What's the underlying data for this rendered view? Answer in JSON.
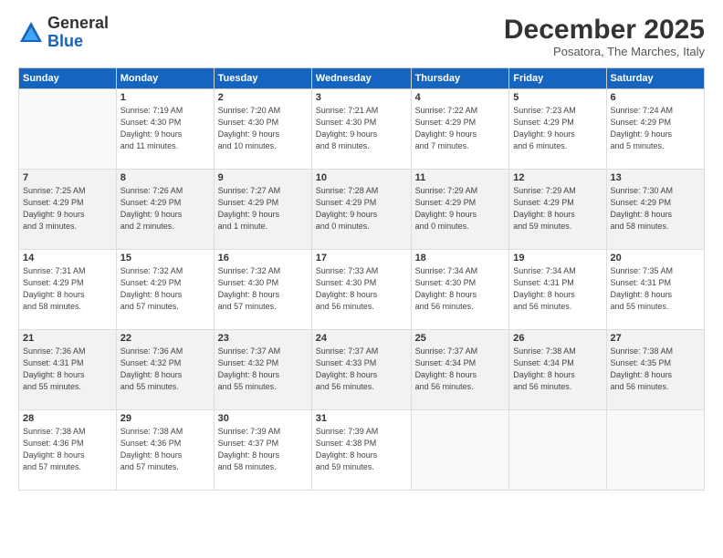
{
  "logo": {
    "general": "General",
    "blue": "Blue"
  },
  "title": "December 2025",
  "subtitle": "Posatora, The Marches, Italy",
  "days_header": [
    "Sunday",
    "Monday",
    "Tuesday",
    "Wednesday",
    "Thursday",
    "Friday",
    "Saturday"
  ],
  "weeks": [
    [
      {
        "num": "",
        "info": ""
      },
      {
        "num": "1",
        "info": "Sunrise: 7:19 AM\nSunset: 4:30 PM\nDaylight: 9 hours\nand 11 minutes."
      },
      {
        "num": "2",
        "info": "Sunrise: 7:20 AM\nSunset: 4:30 PM\nDaylight: 9 hours\nand 10 minutes."
      },
      {
        "num": "3",
        "info": "Sunrise: 7:21 AM\nSunset: 4:30 PM\nDaylight: 9 hours\nand 8 minutes."
      },
      {
        "num": "4",
        "info": "Sunrise: 7:22 AM\nSunset: 4:29 PM\nDaylight: 9 hours\nand 7 minutes."
      },
      {
        "num": "5",
        "info": "Sunrise: 7:23 AM\nSunset: 4:29 PM\nDaylight: 9 hours\nand 6 minutes."
      },
      {
        "num": "6",
        "info": "Sunrise: 7:24 AM\nSunset: 4:29 PM\nDaylight: 9 hours\nand 5 minutes."
      }
    ],
    [
      {
        "num": "7",
        "info": "Sunrise: 7:25 AM\nSunset: 4:29 PM\nDaylight: 9 hours\nand 3 minutes."
      },
      {
        "num": "8",
        "info": "Sunrise: 7:26 AM\nSunset: 4:29 PM\nDaylight: 9 hours\nand 2 minutes."
      },
      {
        "num": "9",
        "info": "Sunrise: 7:27 AM\nSunset: 4:29 PM\nDaylight: 9 hours\nand 1 minute."
      },
      {
        "num": "10",
        "info": "Sunrise: 7:28 AM\nSunset: 4:29 PM\nDaylight: 9 hours\nand 0 minutes."
      },
      {
        "num": "11",
        "info": "Sunrise: 7:29 AM\nSunset: 4:29 PM\nDaylight: 9 hours\nand 0 minutes."
      },
      {
        "num": "12",
        "info": "Sunrise: 7:29 AM\nSunset: 4:29 PM\nDaylight: 8 hours\nand 59 minutes."
      },
      {
        "num": "13",
        "info": "Sunrise: 7:30 AM\nSunset: 4:29 PM\nDaylight: 8 hours\nand 58 minutes."
      }
    ],
    [
      {
        "num": "14",
        "info": "Sunrise: 7:31 AM\nSunset: 4:29 PM\nDaylight: 8 hours\nand 58 minutes."
      },
      {
        "num": "15",
        "info": "Sunrise: 7:32 AM\nSunset: 4:29 PM\nDaylight: 8 hours\nand 57 minutes."
      },
      {
        "num": "16",
        "info": "Sunrise: 7:32 AM\nSunset: 4:30 PM\nDaylight: 8 hours\nand 57 minutes."
      },
      {
        "num": "17",
        "info": "Sunrise: 7:33 AM\nSunset: 4:30 PM\nDaylight: 8 hours\nand 56 minutes."
      },
      {
        "num": "18",
        "info": "Sunrise: 7:34 AM\nSunset: 4:30 PM\nDaylight: 8 hours\nand 56 minutes."
      },
      {
        "num": "19",
        "info": "Sunrise: 7:34 AM\nSunset: 4:31 PM\nDaylight: 8 hours\nand 56 minutes."
      },
      {
        "num": "20",
        "info": "Sunrise: 7:35 AM\nSunset: 4:31 PM\nDaylight: 8 hours\nand 55 minutes."
      }
    ],
    [
      {
        "num": "21",
        "info": "Sunrise: 7:36 AM\nSunset: 4:31 PM\nDaylight: 8 hours\nand 55 minutes."
      },
      {
        "num": "22",
        "info": "Sunrise: 7:36 AM\nSunset: 4:32 PM\nDaylight: 8 hours\nand 55 minutes."
      },
      {
        "num": "23",
        "info": "Sunrise: 7:37 AM\nSunset: 4:32 PM\nDaylight: 8 hours\nand 55 minutes."
      },
      {
        "num": "24",
        "info": "Sunrise: 7:37 AM\nSunset: 4:33 PM\nDaylight: 8 hours\nand 56 minutes."
      },
      {
        "num": "25",
        "info": "Sunrise: 7:37 AM\nSunset: 4:34 PM\nDaylight: 8 hours\nand 56 minutes."
      },
      {
        "num": "26",
        "info": "Sunrise: 7:38 AM\nSunset: 4:34 PM\nDaylight: 8 hours\nand 56 minutes."
      },
      {
        "num": "27",
        "info": "Sunrise: 7:38 AM\nSunset: 4:35 PM\nDaylight: 8 hours\nand 56 minutes."
      }
    ],
    [
      {
        "num": "28",
        "info": "Sunrise: 7:38 AM\nSunset: 4:36 PM\nDaylight: 8 hours\nand 57 minutes."
      },
      {
        "num": "29",
        "info": "Sunrise: 7:38 AM\nSunset: 4:36 PM\nDaylight: 8 hours\nand 57 minutes."
      },
      {
        "num": "30",
        "info": "Sunrise: 7:39 AM\nSunset: 4:37 PM\nDaylight: 8 hours\nand 58 minutes."
      },
      {
        "num": "31",
        "info": "Sunrise: 7:39 AM\nSunset: 4:38 PM\nDaylight: 8 hours\nand 59 minutes."
      },
      {
        "num": "",
        "info": ""
      },
      {
        "num": "",
        "info": ""
      },
      {
        "num": "",
        "info": ""
      }
    ]
  ]
}
